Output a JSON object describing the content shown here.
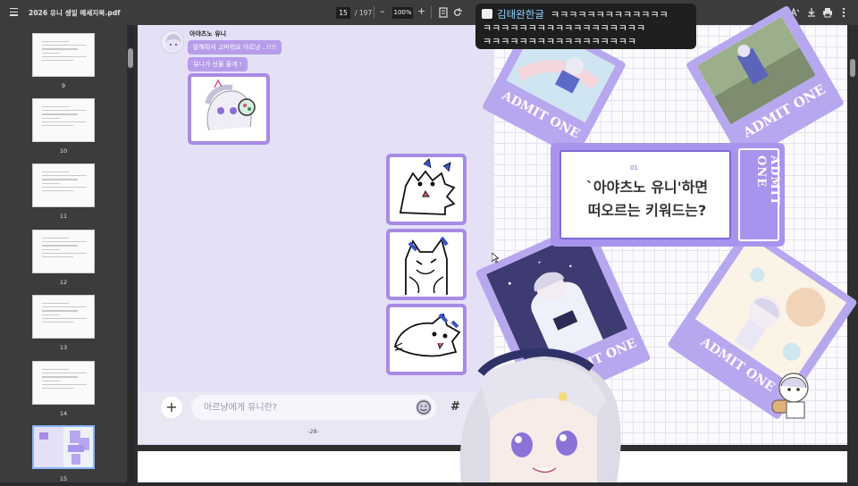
{
  "toolbar": {
    "title": "2026 유니 생일 메세지북.pdf",
    "page_current": "15",
    "page_total": "/ 197",
    "zoom_out": "–",
    "zoom": "100%",
    "zoom_in": "+"
  },
  "sidebar": {
    "thumbnails": [
      {
        "label": "9"
      },
      {
        "label": "10"
      },
      {
        "label": "11"
      },
      {
        "label": "12"
      },
      {
        "label": "13"
      },
      {
        "label": "14"
      },
      {
        "label": "15"
      }
    ]
  },
  "chat": {
    "sender": "아야츠노 유니",
    "messages": [
      "말해줘서 고마워요 아르냥 ..!!!!",
      "유니가 선물 줄게 !"
    ],
    "input_placeholder": "아르냥에게 유니란?",
    "plus": "+",
    "hash": "#"
  },
  "page_number": "-28-",
  "question": {
    "number": "01",
    "line1": "`아야츠노 유니'하면",
    "line2": "떠오르는 키워드는?"
  },
  "tickets": {
    "admit_text": "ADMIT ONE"
  },
  "overlay": {
    "username": "김태완한글",
    "line1": "ㅋㅋㅋㅋㅋㅋㅋㅋㅋㅋㅋㅋㅋ",
    "line2": "ㅋㅋㅋㅋㅋㅋㅋㅋㅋㅋㅋㅋㅋㅋㅋㅋㅋㅋ",
    "line3": "ㅋㅋㅋㅋㅋㅋㅋㅋㅋㅋㅋㅋㅋㅋㅋㅋㅋ"
  },
  "colors": {
    "accent": "#a894ee",
    "bubble": "#b79cea",
    "toolbar": "#3c3c3c"
  }
}
